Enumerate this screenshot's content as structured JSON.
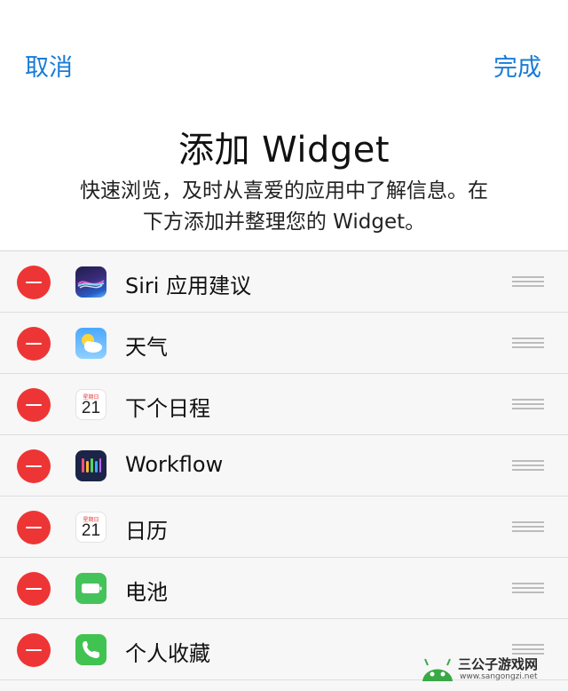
{
  "nav": {
    "cancel_label": "取消",
    "done_label": "完成"
  },
  "page": {
    "title": "添加 Widget",
    "description_line1": "快速浏览，及时从喜爱的应用中了解信息。在",
    "description_line2": "下方添加并整理您的 Widget。"
  },
  "calendar_icon": {
    "day_text": "星期日",
    "date_text": "21"
  },
  "widgets": [
    {
      "label": "Siri 应用建议",
      "icon": "siri-suggestions-icon"
    },
    {
      "label": "天气",
      "icon": "weather-icon"
    },
    {
      "label": "下个日程",
      "icon": "calendar-icon"
    },
    {
      "label": "Workflow",
      "icon": "workflow-icon"
    },
    {
      "label": "日历",
      "icon": "calendar-icon"
    },
    {
      "label": "电池",
      "icon": "battery-icon"
    },
    {
      "label": "个人收藏",
      "icon": "phone-icon"
    }
  ],
  "colors": {
    "accent": "#1a7bd6",
    "delete_red": "#ee3535"
  },
  "watermark": {
    "title": "三公子游戏网",
    "url": "www.sangongzi.net"
  }
}
